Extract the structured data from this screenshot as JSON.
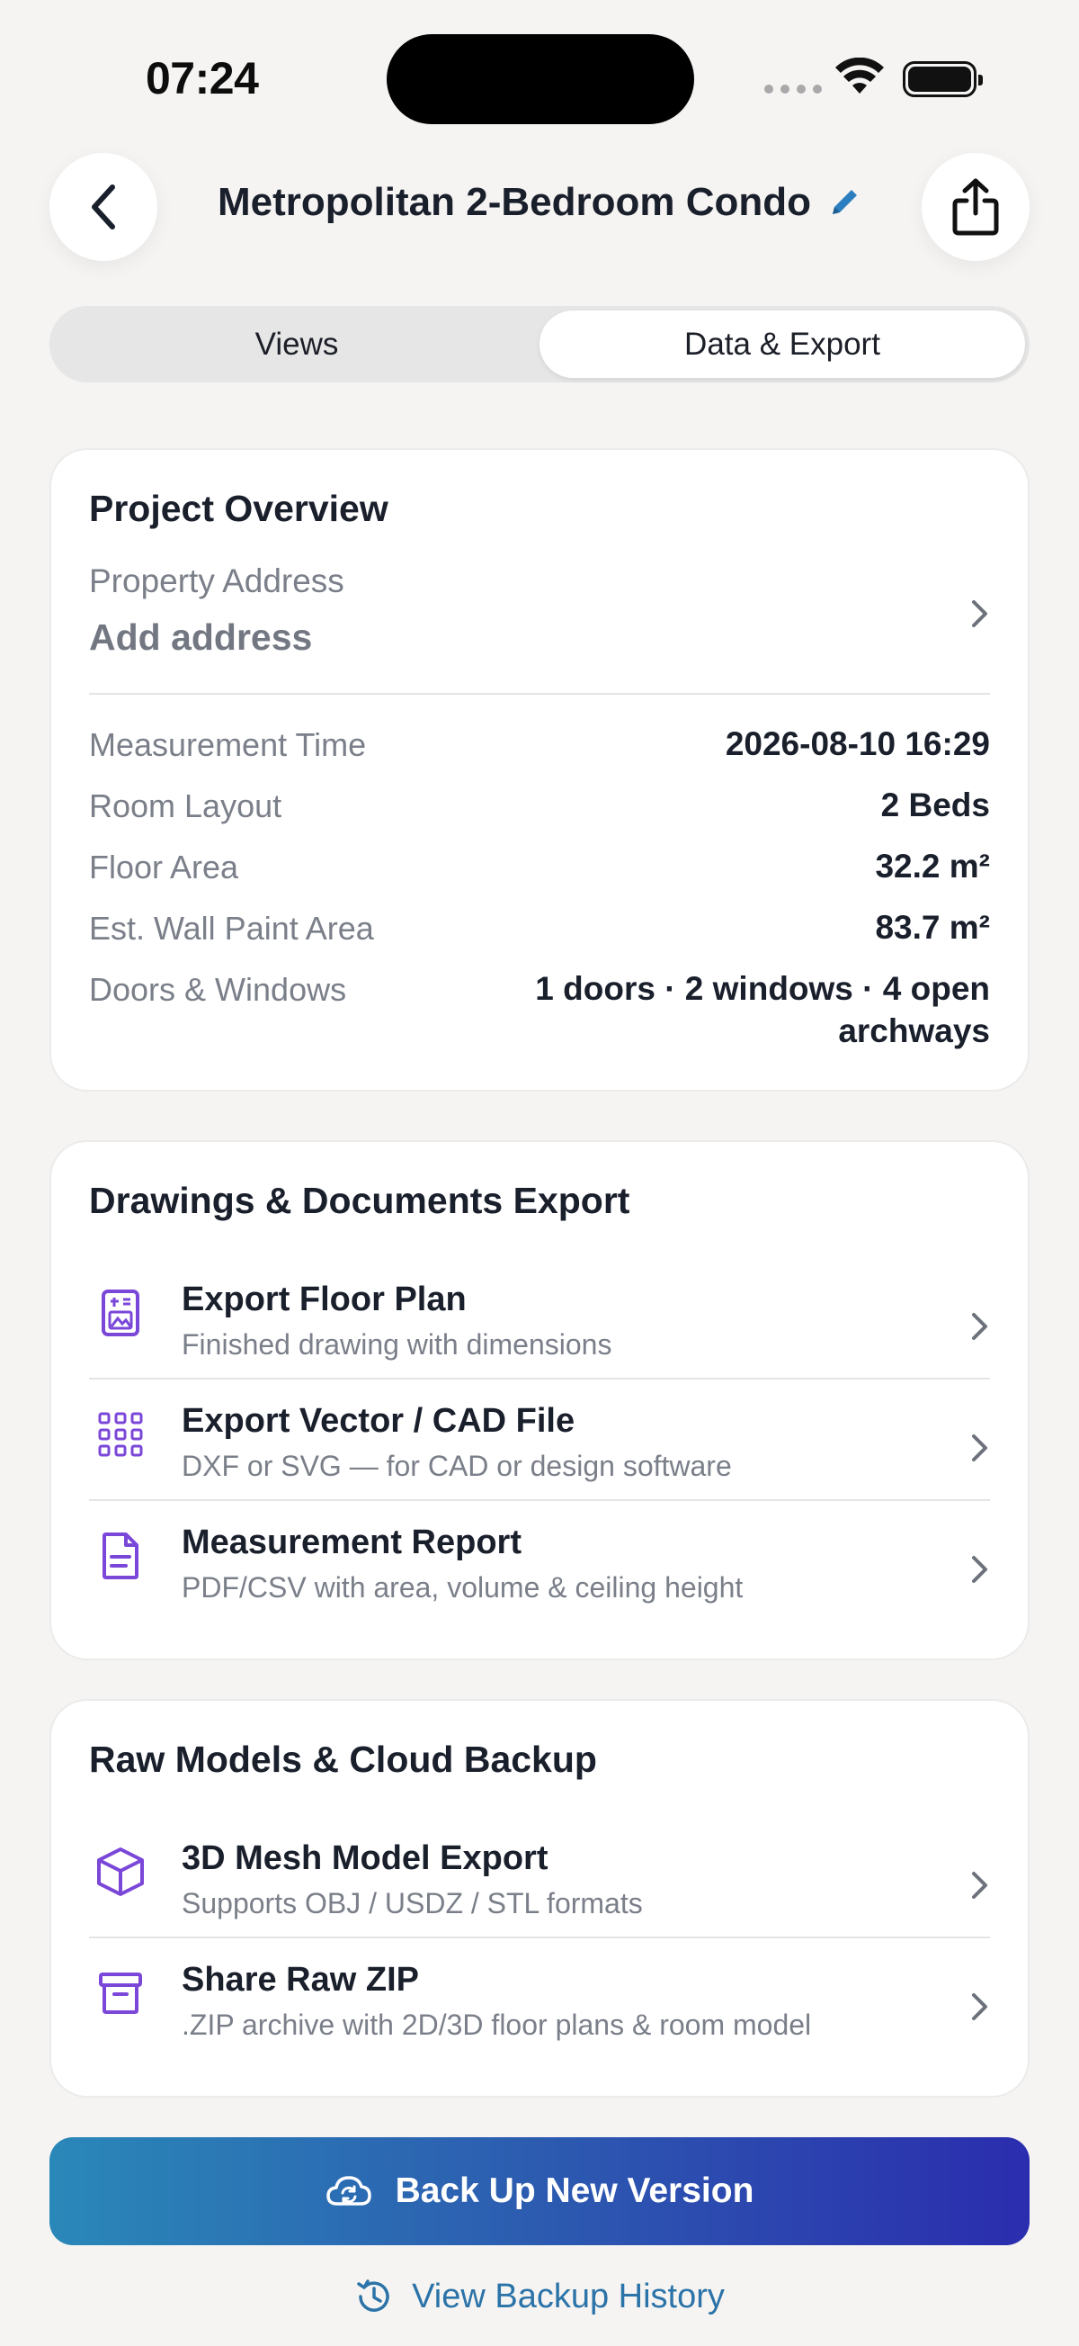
{
  "status_bar": {
    "time": "07:24"
  },
  "header": {
    "title": "Metropolitan 2-Bedroom Condo",
    "icons": {
      "back": "chevron-left-icon",
      "edit": "pencil-icon",
      "share": "share-icon"
    }
  },
  "tabs": [
    {
      "label": "Views",
      "active": false
    },
    {
      "label": "Data & Export",
      "active": true
    }
  ],
  "overview": {
    "title": "Project Overview",
    "address_label": "Property Address",
    "address_value": "Add address",
    "rows": [
      {
        "label": "Measurement Time",
        "value": "2026-08-10 16:29"
      },
      {
        "label": "Room Layout",
        "value": "2 Beds"
      },
      {
        "label": "Floor Area",
        "value": "32.2 m²"
      },
      {
        "label": "Est. Wall Paint Area",
        "value": "83.7 m²"
      },
      {
        "label": "Doors & Windows",
        "value_line1": "1 doors · 2 windows · 4 open",
        "value_line2": "archways"
      }
    ]
  },
  "drawings": {
    "title": "Drawings & Documents Export",
    "items": [
      {
        "icon": "floor-plan-icon",
        "title": "Export Floor Plan",
        "subtitle": "Finished drawing with dimensions"
      },
      {
        "icon": "grid-icon",
        "title": "Export Vector / CAD File",
        "subtitle": "DXF or SVG — for CAD or design software"
      },
      {
        "icon": "document-icon",
        "title": "Measurement Report",
        "subtitle": "PDF/CSV with area, volume & ceiling height"
      }
    ]
  },
  "raw": {
    "title": "Raw Models & Cloud Backup",
    "items": [
      {
        "icon": "cube-icon",
        "title": "3D Mesh Model Export",
        "subtitle": "Supports OBJ / USDZ / STL formats"
      },
      {
        "icon": "archive-icon",
        "title": "Share Raw ZIP",
        "subtitle": ".ZIP archive with 2D/3D floor plans & room model"
      }
    ]
  },
  "actions": {
    "backup_label": "Back Up New Version",
    "history_label": "View Backup History"
  },
  "colors": {
    "accent_purple": "#7b47d9",
    "link_blue": "#2b73a8",
    "gradient_start": "#2a88b8",
    "gradient_end": "#2b2dae",
    "background": "#f5f4f2"
  }
}
